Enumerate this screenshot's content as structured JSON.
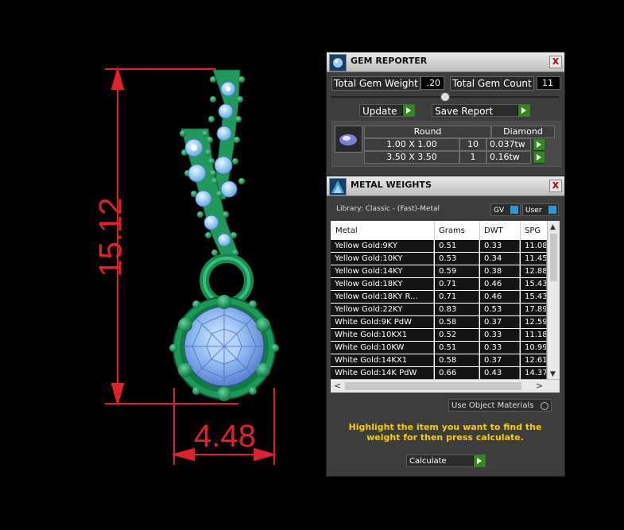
{
  "viewport": {
    "height_label": "15.12",
    "width_label": "4.48"
  },
  "gem_reporter": {
    "title": "GEM REPORTER",
    "close": "X",
    "total_weight_label": "Total Gem Weight",
    "total_weight_value": ".20",
    "total_count_label": "Total Gem Count",
    "total_count_value": "11",
    "update_label": "Update",
    "save_label": "Save Report",
    "table": {
      "headers": [
        "Round",
        "Diamond"
      ],
      "rows": [
        {
          "size": "1.00 X 1.00",
          "count": "10",
          "weight": "0.037tw"
        },
        {
          "size": "3.50 X 3.50",
          "count": "1",
          "weight": "0.16tw"
        }
      ]
    }
  },
  "metal_weights": {
    "title": "METAL WEIGHTS",
    "close": "X",
    "library": "Library: Classic - (Fast)-Metal",
    "gv_label": "GV",
    "user_label": "User",
    "columns": [
      "Metal",
      "Grams",
      "DWT",
      "SPG"
    ],
    "rows": [
      [
        "Yellow Gold:9KY",
        "0.51",
        "0.33",
        "11.08"
      ],
      [
        "Yellow Gold:10KY",
        "0.53",
        "0.34",
        "11.45"
      ],
      [
        "Yellow Gold:14KY",
        "0.59",
        "0.38",
        "12.88"
      ],
      [
        "Yellow Gold:18KY",
        "0.71",
        "0.46",
        "15.43"
      ],
      [
        "Yellow Gold:18KY R...",
        "0.71",
        "0.46",
        "15.43"
      ],
      [
        "Yellow Gold:22KY",
        "0.83",
        "0.53",
        "17.89"
      ],
      [
        "White Gold:9K PdW",
        "0.58",
        "0.37",
        "12.59"
      ],
      [
        "White Gold:10KX1",
        "0.52",
        "0.33",
        "11.18"
      ],
      [
        "White Gold:10KW",
        "0.51",
        "0.33",
        "10.99"
      ],
      [
        "White Gold:14KX1",
        "0.58",
        "0.37",
        "12.61"
      ],
      [
        "White Gold:14K PdW",
        "0.66",
        "0.43",
        "14.37"
      ]
    ],
    "use_object_materials": "Use Object Materials",
    "hint": "Highlight the item you want to find the weight for then press calculate.",
    "calculate_label": "Calculate"
  }
}
